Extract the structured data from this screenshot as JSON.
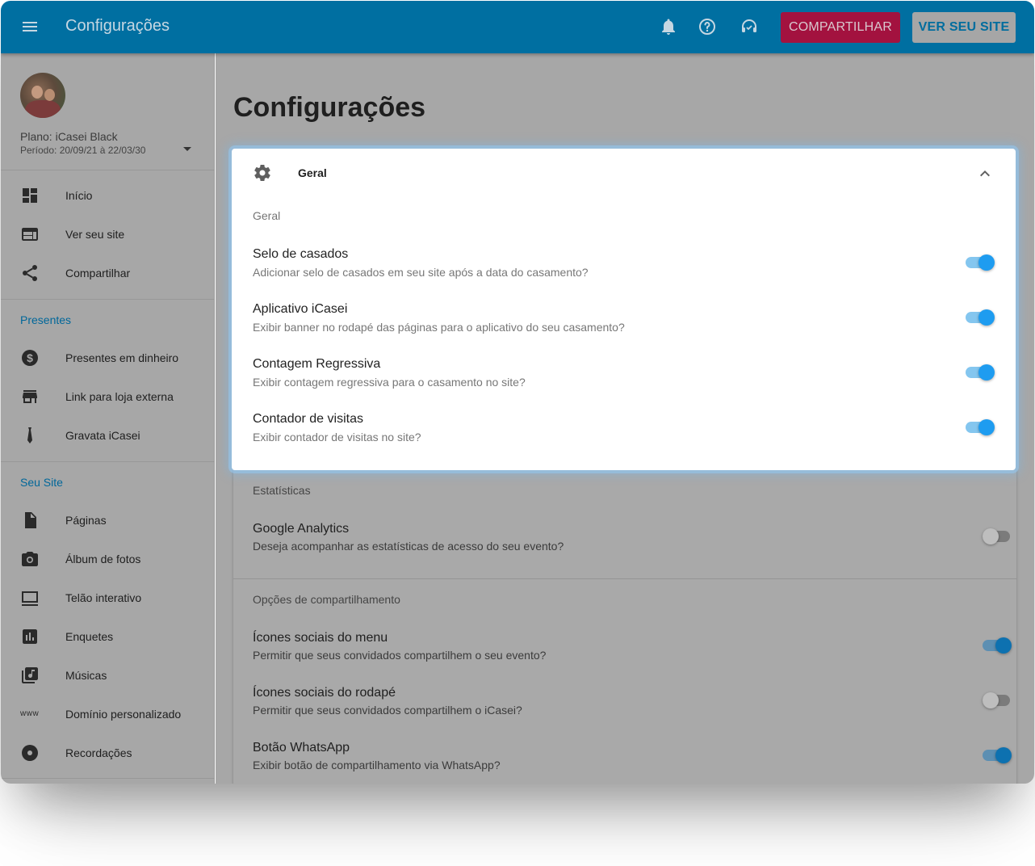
{
  "header": {
    "title": "Configurações",
    "share_button": "COMPARTILHAR",
    "view_site_button": "VER SEU SITE"
  },
  "sidebar": {
    "plan": "Plano: iCasei Black",
    "period": "Período: 20/09/21 à 22/03/30",
    "top_items": [
      {
        "label": "Início",
        "icon": "dashboard-icon"
      },
      {
        "label": "Ver seu site",
        "icon": "web-icon"
      },
      {
        "label": "Compartilhar",
        "icon": "share-icon"
      }
    ],
    "gifts_section": "Presentes",
    "gift_items": [
      {
        "label": "Presentes em dinheiro",
        "icon": "money-icon"
      },
      {
        "label": "Link para loja externa",
        "icon": "store-icon"
      },
      {
        "label": "Gravata iCasei",
        "icon": "tie-icon"
      }
    ],
    "site_section": "Seu Site",
    "site_items": [
      {
        "label": "Páginas",
        "icon": "page-icon"
      },
      {
        "label": "Álbum de fotos",
        "icon": "camera-icon"
      },
      {
        "label": "Telão interativo",
        "icon": "screen-icon"
      },
      {
        "label": "Enquetes",
        "icon": "poll-icon"
      },
      {
        "label": "Músicas",
        "icon": "music-icon"
      },
      {
        "label": "Domínio personalizado",
        "icon": "www-icon"
      },
      {
        "label": "Recordações",
        "icon": "disc-icon"
      }
    ],
    "www_glyph": "www"
  },
  "main": {
    "page_title": "Configurações",
    "general_card": {
      "title": "Geral",
      "subheader": "Geral",
      "options": [
        {
          "title": "Selo de casados",
          "desc": "Adicionar selo de casados em seu site após a data do casamento?",
          "enabled": true
        },
        {
          "title": "Aplicativo iCasei",
          "desc": "Exibir banner no rodapé das páginas para o aplicativo do seu casamento?",
          "enabled": true
        },
        {
          "title": "Contagem Regressiva",
          "desc": "Exibir contagem regressiva para o casamento no site?",
          "enabled": true
        },
        {
          "title": "Contador de visitas",
          "desc": "Exibir contador de visitas no site?",
          "enabled": true
        }
      ]
    },
    "stats": {
      "subheader": "Estatísticas",
      "options": [
        {
          "title": "Google Analytics",
          "desc": "Deseja acompanhar as estatísticas de acesso do seu evento?",
          "enabled": false
        }
      ]
    },
    "sharing": {
      "subheader": "Opções de compartilhamento",
      "options": [
        {
          "title": "Ícones sociais do menu",
          "desc": "Permitir que seus convidados compartilhem o seu evento?",
          "enabled": true
        },
        {
          "title": "Ícones sociais do rodapé",
          "desc": "Permitir que seus convidados compartilhem o iCasei?",
          "enabled": false
        },
        {
          "title": "Botão WhatsApp",
          "desc": "Exibir botão de compartilhamento via WhatsApp?",
          "enabled": true
        }
      ]
    }
  },
  "colors": {
    "topbar": "#006fa1",
    "share_button": "#a3123f",
    "accent": "#1e9cf0",
    "overlay_gray": "#a7a7a7"
  }
}
